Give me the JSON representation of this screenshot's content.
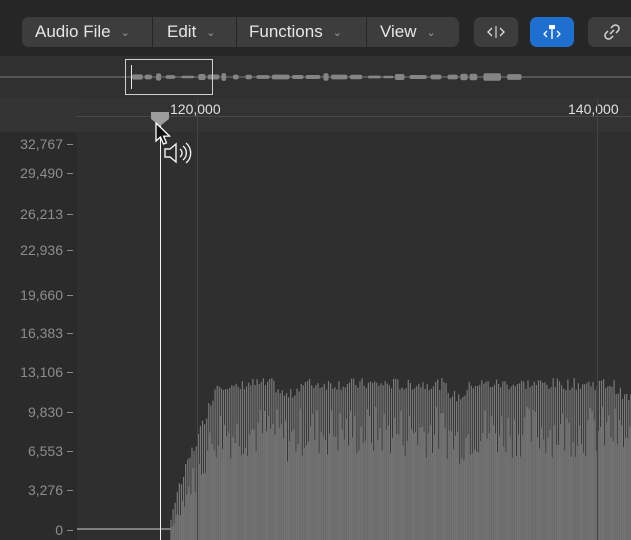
{
  "menu": {
    "audio_file": "Audio File",
    "edit": "Edit",
    "functions": "Functions",
    "view": "View"
  },
  "tools": [
    {
      "name": "selection-tool",
      "icon": "split-arrows-icon",
      "active": false
    },
    {
      "name": "anchor-tool",
      "icon": "anchor-marker-icon",
      "active": true
    },
    {
      "name": "link-tool",
      "icon": "link-icon",
      "active": false
    }
  ],
  "ruler": {
    "labels": [
      "120,000",
      "140,000"
    ]
  },
  "y_axis": {
    "labels": [
      "32,767",
      "29,490",
      "26,213",
      "22,936",
      "19,660",
      "16,383",
      "13,106",
      "9,830",
      "6,553",
      "3,276",
      "0"
    ]
  },
  "colors": {
    "accent": "#1f6fd1",
    "waveform": "#6e6e6e",
    "playhead": "#f4f4f4"
  }
}
